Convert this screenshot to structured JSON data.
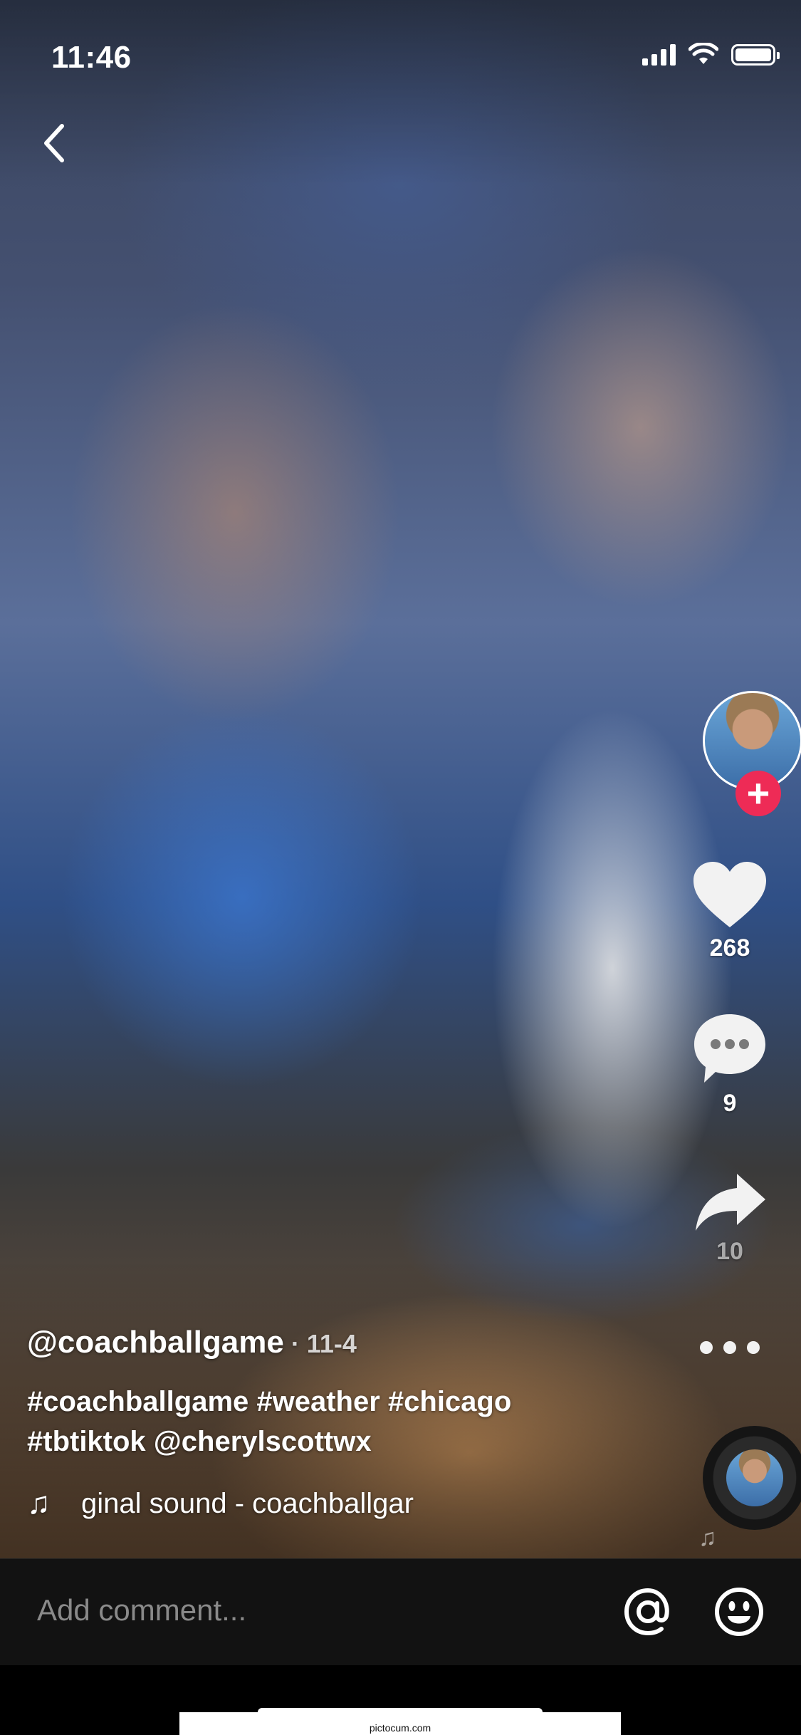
{
  "status_bar": {
    "time": "11:46",
    "icons": [
      "cellular-signal-icon",
      "wifi-icon",
      "battery-icon"
    ]
  },
  "navigation": {
    "back_icon": "chevron-left-icon"
  },
  "right_rail": {
    "avatar_icon": "creator-avatar",
    "follow_icon": "plus-icon",
    "like": {
      "icon": "heart-icon",
      "count": "268"
    },
    "comment": {
      "icon": "comment-bubble-icon",
      "count": "9"
    },
    "share": {
      "icon": "share-arrow-icon",
      "count": "10"
    },
    "more_icon": "more-dots-icon",
    "music_disc_icon": "music-disc"
  },
  "post": {
    "username": "@coachballgame",
    "date": "· 11-4",
    "caption_line1": "#coachballgame #weather #chicago",
    "caption_line2": "#tbtiktok @cherylscottwx",
    "sound_icon": "music-note-icon",
    "sound": "ginal sound - coachballgar"
  },
  "comment_bar": {
    "placeholder": "Add comment...",
    "mention_icon": "at-sign-icon",
    "emoji_icon": "smiley-icon"
  },
  "footer": {
    "watermark": "pictocum.com"
  },
  "colors": {
    "follow_badge": "#ee2b56",
    "comment_bar_bg": "#121212",
    "placeholder_text": "#8a8a8a"
  }
}
